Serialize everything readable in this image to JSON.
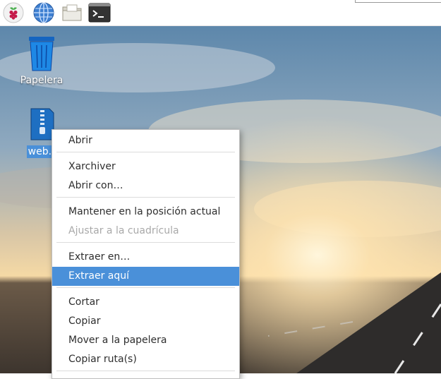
{
  "taskbar": {
    "buttons": [
      {
        "name": "raspberry-menu-button",
        "icon": "raspberry-icon"
      },
      {
        "name": "web-browser-button",
        "icon": "globe-icon"
      },
      {
        "name": "file-manager-button",
        "icon": "folder-icon"
      },
      {
        "name": "terminal-button",
        "icon": "terminal-icon"
      }
    ]
  },
  "desktop": {
    "trash_label": "Papelera",
    "zip_file_label": "web.z"
  },
  "context_menu": {
    "items": [
      {
        "label": "Abrir",
        "enabled": true
      },
      {
        "label": "Xarchiver",
        "enabled": true
      },
      {
        "label": "Abrir con…",
        "enabled": true
      },
      {
        "label": "Mantener en la posición actual",
        "enabled": true
      },
      {
        "label": "Ajustar a la cuadrícula",
        "enabled": false
      },
      {
        "label": "Extraer en…",
        "enabled": true
      },
      {
        "label": "Extraer aquí",
        "enabled": true,
        "highlighted": true
      },
      {
        "label": "Cortar",
        "enabled": true
      },
      {
        "label": "Copiar",
        "enabled": true
      },
      {
        "label": "Mover a la papelera",
        "enabled": true
      },
      {
        "label": "Copiar ruta(s)",
        "enabled": true
      }
    ]
  },
  "colors": {
    "menu_highlight": "#4a90d9",
    "selection": "#4a90d9",
    "disabled_text": "#a9a9a9"
  }
}
